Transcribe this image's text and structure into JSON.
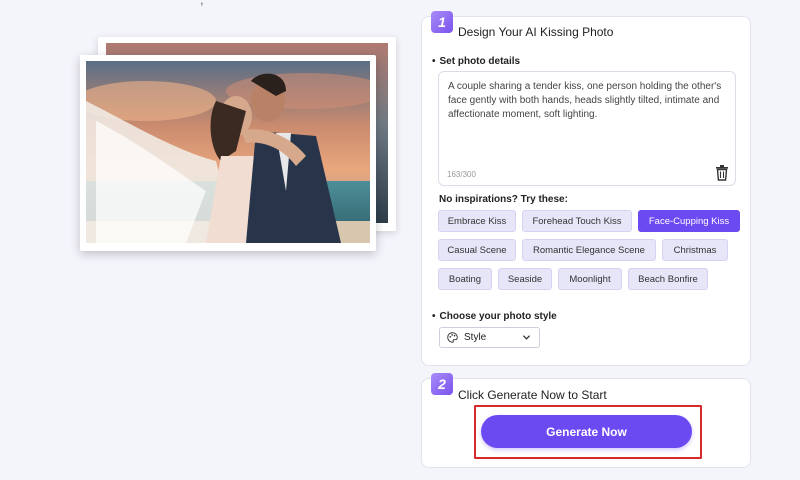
{
  "step1": {
    "number": "1",
    "title": "Design Your AI Kissing Photo",
    "details_label": "Set photo details",
    "prompt_text": "A couple sharing a tender kiss, one person holding the other's face gently with both hands, heads slightly tilted, intimate and affectionate moment, soft lighting.",
    "char_count": "163/300",
    "inspirations_label": "No inspirations?  Try these:",
    "chips": [
      {
        "label": "Embrace Kiss",
        "active": false
      },
      {
        "label": "Forehead Touch Kiss",
        "active": false
      },
      {
        "label": "Face-Cupping Kiss",
        "active": true
      },
      {
        "label": "Casual Scene",
        "active": false
      },
      {
        "label": "Romantic Elegance Scene",
        "active": false
      },
      {
        "label": "Christmas",
        "active": false
      },
      {
        "label": "Boating",
        "active": false
      },
      {
        "label": "Seaside",
        "active": false
      },
      {
        "label": "Moonlight",
        "active": false
      },
      {
        "label": "Beach Bonfire",
        "active": false
      }
    ],
    "style_label": "Choose your photo style",
    "style_value": "Style"
  },
  "step2": {
    "number": "2",
    "title": "Click Generate Now to Start",
    "button_label": "Generate Now"
  },
  "colors": {
    "accent": "#6c4af2",
    "highlight": "#d42a2a",
    "chip_bg": "#e7e6f8"
  }
}
